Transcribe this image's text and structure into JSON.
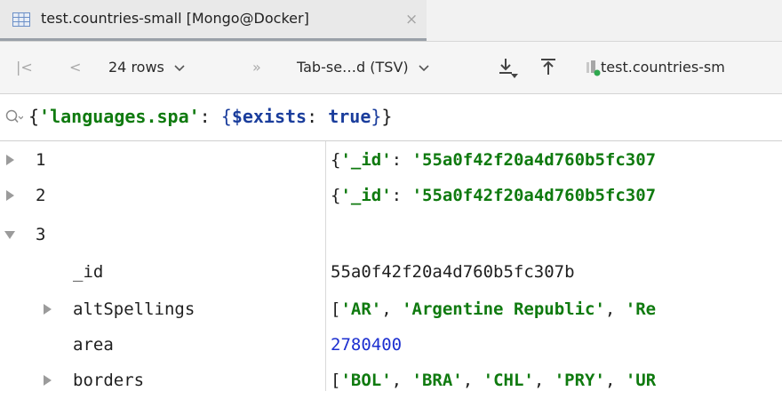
{
  "tab": {
    "title": "test.countries-small [Mongo@Docker]",
    "close_glyph": "×",
    "icon": "table-icon"
  },
  "toolbar": {
    "first_glyph": "|<",
    "prev_glyph": "<",
    "rows_label": "24 rows",
    "more_glyph": "»",
    "export_format": "Tab-se…d (TSV)",
    "download_icon": "download-icon",
    "upload_icon": "upload-icon",
    "datasource_label": "test.countries-sm"
  },
  "filter": {
    "icon": "search-icon",
    "open_brace": "{",
    "key": "'languages.spa'",
    "colon": ":",
    "inner_open": "{",
    "operator": "$exists",
    "colon2": ":",
    "value": "true",
    "inner_close": "}",
    "close_brace": "}"
  },
  "rows": [
    {
      "key": "1",
      "expanded": false,
      "value": {
        "open": "{",
        "field": "'_id'",
        "colon": ":",
        "str": "'55a0f42f20a4d760b5fc307"
      }
    },
    {
      "key": "2",
      "expanded": false,
      "value": {
        "open": "{",
        "field": "'_id'",
        "colon": ":",
        "str": "'55a0f42f20a4d760b5fc307"
      }
    },
    {
      "key": "3",
      "expanded": true,
      "value": {}
    },
    {
      "key": "_id",
      "value": {
        "text": "55a0f42f20a4d760b5fc307b"
      }
    },
    {
      "key": "altSpellings",
      "expanded": false,
      "value": {
        "open": "[",
        "items": [
          "'AR'",
          "'Argentine Republic'",
          "'Re"
        ]
      }
    },
    {
      "key": "area",
      "value": {
        "number": "2780400"
      }
    },
    {
      "key": "borders",
      "expanded": false,
      "value": {
        "open": "[",
        "items": [
          "'BOL'",
          "'BRA'",
          "'CHL'",
          "'PRY'",
          "'UR"
        ]
      }
    }
  ],
  "colors": {
    "string": "#0f7a0f",
    "keyword": "#1a3d9c",
    "number": "#1c2fd0",
    "tab_underline": "#9aa0a8"
  }
}
